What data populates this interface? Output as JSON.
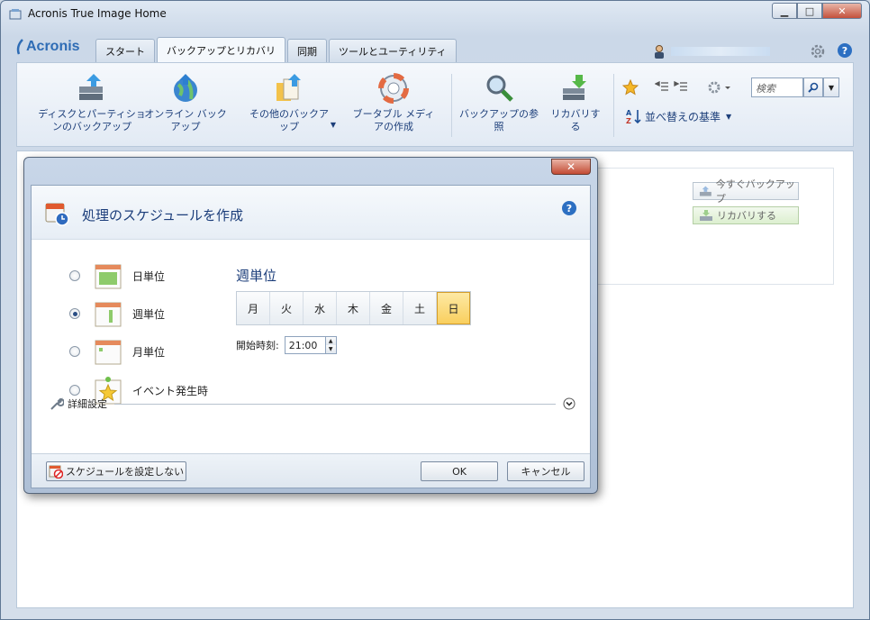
{
  "window": {
    "title": "Acronis True Image Home"
  },
  "brand": {
    "logo_text": "Acronis"
  },
  "tabs": [
    {
      "label": "スタート",
      "active": false
    },
    {
      "label": "バックアップとリカバリ",
      "active": true
    },
    {
      "label": "同期",
      "active": false
    },
    {
      "label": "ツールとユーティリティ",
      "active": false
    }
  ],
  "toolbar": {
    "disk_backup": "ディスクとパーティションのバックアップ",
    "online_backup": "オンライン バックアップ",
    "other_backup": "その他のバックアップ",
    "portable_media": "ブータブル メディアの作成",
    "browse_backup": "バックアップの参照",
    "recover": "リカバリする",
    "sort_label": "並べ替えの基準",
    "search_placeholder": "検索"
  },
  "content": {
    "backup_now": "今すぐバックアップ",
    "recover": "リカバリする"
  },
  "dialog": {
    "title": "処理のスケジュールを作成",
    "options": [
      {
        "label": "日単位",
        "selected": false
      },
      {
        "label": "週単位",
        "selected": true
      },
      {
        "label": "月単位",
        "selected": false
      },
      {
        "label": "イベント発生時",
        "selected": false
      }
    ],
    "section_title": "週単位",
    "days": [
      {
        "label": "月",
        "selected": false
      },
      {
        "label": "火",
        "selected": false
      },
      {
        "label": "水",
        "selected": false
      },
      {
        "label": "木",
        "selected": false
      },
      {
        "label": "金",
        "selected": false
      },
      {
        "label": "土",
        "selected": false
      },
      {
        "label": "日",
        "selected": true
      }
    ],
    "start_time_label": "開始時刻:",
    "start_time_value": "21:00",
    "advanced_label": "詳細設定",
    "no_schedule_button": "スケジュールを設定しない",
    "ok_button": "OK",
    "cancel_button": "キャンセル"
  },
  "colors": {
    "accent": "#1b3d7a",
    "selected_day": "#f9cf5e",
    "close_button": "#c34a33"
  }
}
